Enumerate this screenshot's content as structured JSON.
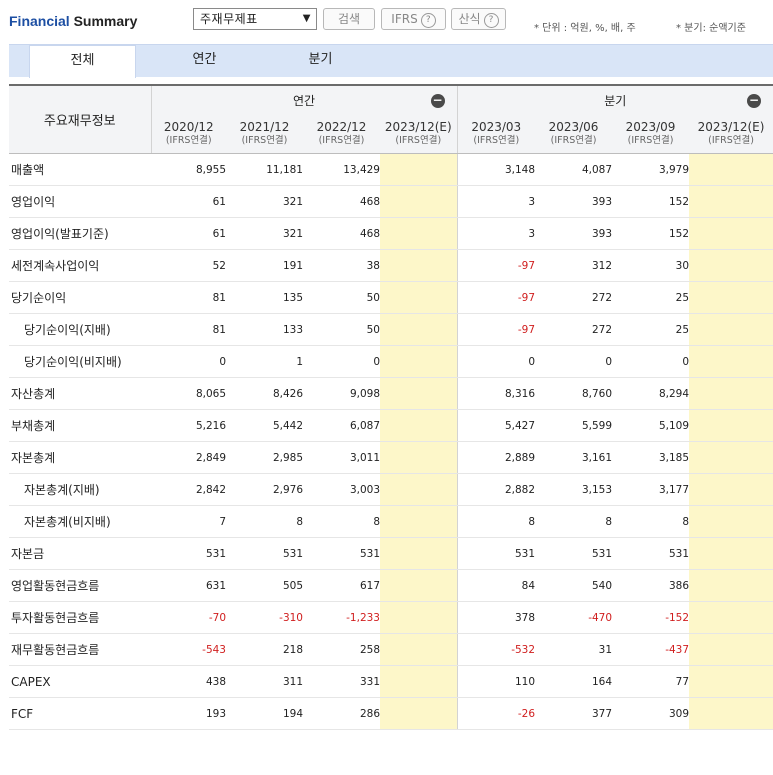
{
  "brand": {
    "part1": "Financial",
    "part2": " Summary"
  },
  "toolbar": {
    "select_value": "주재무제표",
    "search_label": "검색",
    "ifrs_label": "IFRS",
    "calc_label": "산식",
    "help_glyph": "?"
  },
  "notes": {
    "unit": "* 단위 : 억원, %, 배, 주",
    "quarter": "* 분기: 순액기준"
  },
  "tabs": [
    {
      "label": "전체"
    },
    {
      "label": "연간"
    },
    {
      "label": "분기"
    }
  ],
  "table": {
    "corner_label": "주요재무정보",
    "group_annual": "연간",
    "group_quarter": "분기",
    "collapse_glyph": "−",
    "columns": [
      {
        "period": "2020/12",
        "basis": "(IFRS연결)"
      },
      {
        "period": "2021/12",
        "basis": "(IFRS연결)"
      },
      {
        "period": "2022/12",
        "basis": "(IFRS연결)"
      },
      {
        "period": "2023/12(E)",
        "basis": "(IFRS연결)"
      },
      {
        "period": "2023/03",
        "basis": "(IFRS연결)"
      },
      {
        "period": "2023/06",
        "basis": "(IFRS연결)"
      },
      {
        "period": "2023/09",
        "basis": "(IFRS연결)"
      },
      {
        "period": "2023/12(E)",
        "basis": "(IFRS연결)"
      }
    ],
    "rows": [
      {
        "label": "매출액",
        "indent": false,
        "values": [
          "8,955",
          "11,181",
          "13,429",
          "",
          "3,148",
          "4,087",
          "3,979",
          ""
        ]
      },
      {
        "label": "영업이익",
        "indent": false,
        "values": [
          "61",
          "321",
          "468",
          "",
          "3",
          "393",
          "152",
          ""
        ]
      },
      {
        "label": "영업이익(발표기준)",
        "indent": false,
        "values": [
          "61",
          "321",
          "468",
          "",
          "3",
          "393",
          "152",
          ""
        ]
      },
      {
        "label": "세전계속사업이익",
        "indent": false,
        "values": [
          "52",
          "191",
          "38",
          "",
          "-97",
          "312",
          "30",
          ""
        ]
      },
      {
        "label": "당기순이익",
        "indent": false,
        "values": [
          "81",
          "135",
          "50",
          "",
          "-97",
          "272",
          "25",
          ""
        ]
      },
      {
        "label": "당기순이익(지배)",
        "indent": true,
        "values": [
          "81",
          "133",
          "50",
          "",
          "-97",
          "272",
          "25",
          ""
        ]
      },
      {
        "label": "당기순이익(비지배)",
        "indent": true,
        "values": [
          "0",
          "1",
          "0",
          "",
          "0",
          "0",
          "0",
          ""
        ]
      },
      {
        "label": "자산총계",
        "indent": false,
        "values": [
          "8,065",
          "8,426",
          "9,098",
          "",
          "8,316",
          "8,760",
          "8,294",
          ""
        ]
      },
      {
        "label": "부채총계",
        "indent": false,
        "values": [
          "5,216",
          "5,442",
          "6,087",
          "",
          "5,427",
          "5,599",
          "5,109",
          ""
        ]
      },
      {
        "label": "자본총계",
        "indent": false,
        "values": [
          "2,849",
          "2,985",
          "3,011",
          "",
          "2,889",
          "3,161",
          "3,185",
          ""
        ]
      },
      {
        "label": "자본총계(지배)",
        "indent": true,
        "values": [
          "2,842",
          "2,976",
          "3,003",
          "",
          "2,882",
          "3,153",
          "3,177",
          ""
        ]
      },
      {
        "label": "자본총계(비지배)",
        "indent": true,
        "values": [
          "7",
          "8",
          "8",
          "",
          "8",
          "8",
          "8",
          ""
        ]
      },
      {
        "label": "자본금",
        "indent": false,
        "values": [
          "531",
          "531",
          "531",
          "",
          "531",
          "531",
          "531",
          ""
        ]
      },
      {
        "label": "영업활동현금흐름",
        "indent": false,
        "values": [
          "631",
          "505",
          "617",
          "",
          "84",
          "540",
          "386",
          ""
        ]
      },
      {
        "label": "투자활동현금흐름",
        "indent": false,
        "values": [
          "-70",
          "-310",
          "-1,233",
          "",
          "378",
          "-470",
          "-152",
          ""
        ]
      },
      {
        "label": "재무활동현금흐름",
        "indent": false,
        "values": [
          "-543",
          "218",
          "258",
          "",
          "-532",
          "31",
          "-437",
          ""
        ]
      },
      {
        "label": "CAPEX",
        "indent": false,
        "values": [
          "438",
          "311",
          "331",
          "",
          "110",
          "164",
          "77",
          ""
        ]
      },
      {
        "label": "FCF",
        "indent": false,
        "values": [
          "193",
          "194",
          "286",
          "",
          "-26",
          "377",
          "309",
          ""
        ]
      }
    ]
  },
  "colors": {
    "brand_blue": "#1d4fa3",
    "negative": "#d01e1e",
    "estimate_bg": "#fdf7c9",
    "tabbar_bg": "#d9e5f7"
  }
}
